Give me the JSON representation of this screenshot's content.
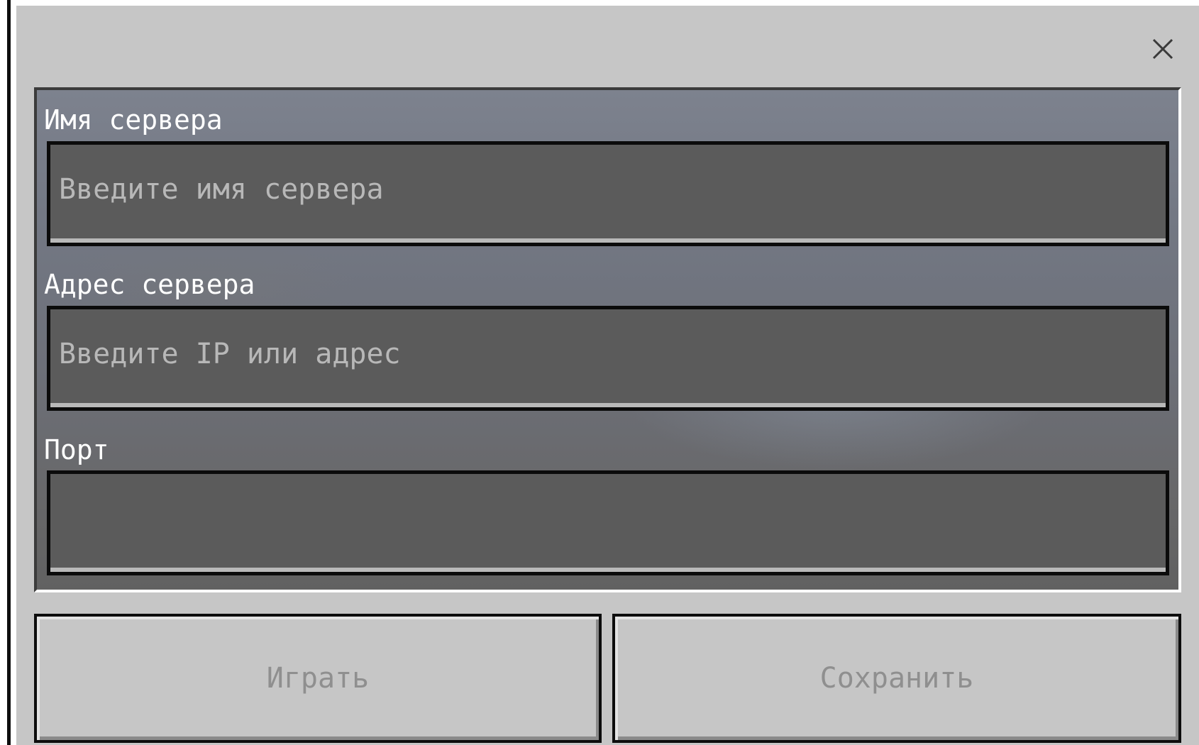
{
  "dialog": {
    "close_icon": "close-icon",
    "fields": [
      {
        "label": "Имя сервера",
        "placeholder": "Введите имя сервера",
        "value": ""
      },
      {
        "label": "Адрес сервера",
        "placeholder": "Введите IP или адрес",
        "value": ""
      },
      {
        "label": "Порт",
        "placeholder": "",
        "value": ""
      }
    ],
    "buttons": {
      "play_label": "Играть",
      "save_label": "Сохранить"
    }
  },
  "colors": {
    "dialog_bg": "#c6c6c6",
    "field_bg": "#5b5b5b",
    "label_text": "#ffffff",
    "disabled_button_text": "#8f8f8f"
  }
}
